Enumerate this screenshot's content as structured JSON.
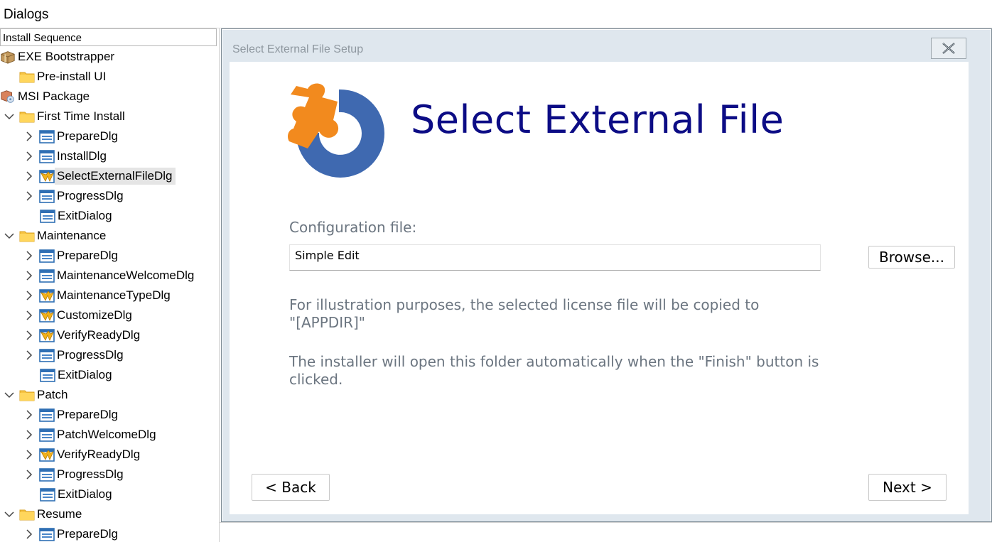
{
  "window": {
    "title": "Dialogs"
  },
  "sequence": {
    "selected": "Install Sequence"
  },
  "tree": [
    {
      "label": "EXE Bootstrapper",
      "icon": "package-icon",
      "arrow": false
    },
    {
      "label": "Pre-install UI",
      "icon": "folder-icon",
      "arrow": false
    },
    {
      "label": "MSI Package",
      "icon": "msi-package-icon",
      "arrow": false
    },
    {
      "label": "First Time Install",
      "icon": "folder-icon",
      "arrow": "down"
    },
    {
      "label": "PrepareDlg",
      "icon": "dialog-icon",
      "arrow": "right"
    },
    {
      "label": "InstallDlg",
      "icon": "dialog-icon",
      "arrow": "right"
    },
    {
      "label": "SelectExternalFileDlg",
      "icon": "custom-dialog-icon",
      "arrow": "right",
      "selected": true
    },
    {
      "label": "ProgressDlg",
      "icon": "dialog-icon",
      "arrow": "right"
    },
    {
      "label": "ExitDialog",
      "icon": "dialog-icon",
      "arrow": false
    },
    {
      "label": "Maintenance",
      "icon": "folder-icon",
      "arrow": "down"
    },
    {
      "label": "PrepareDlg",
      "icon": "dialog-icon",
      "arrow": "right"
    },
    {
      "label": "MaintenanceWelcomeDlg",
      "icon": "dialog-icon",
      "arrow": "right"
    },
    {
      "label": "MaintenanceTypeDlg",
      "icon": "custom-dialog-icon",
      "arrow": "right"
    },
    {
      "label": "CustomizeDlg",
      "icon": "custom-dialog-icon",
      "arrow": "right"
    },
    {
      "label": "VerifyReadyDlg",
      "icon": "custom-dialog-icon",
      "arrow": "right"
    },
    {
      "label": "ProgressDlg",
      "icon": "dialog-icon",
      "arrow": "right"
    },
    {
      "label": "ExitDialog",
      "icon": "dialog-icon",
      "arrow": false
    },
    {
      "label": "Patch",
      "icon": "folder-icon",
      "arrow": "down"
    },
    {
      "label": "PrepareDlg",
      "icon": "dialog-icon",
      "arrow": "right"
    },
    {
      "label": "PatchWelcomeDlg",
      "icon": "dialog-icon",
      "arrow": "right"
    },
    {
      "label": "VerifyReadyDlg",
      "icon": "custom-dialog-icon",
      "arrow": "right"
    },
    {
      "label": "ProgressDlg",
      "icon": "dialog-icon",
      "arrow": "right"
    },
    {
      "label": "ExitDialog",
      "icon": "dialog-icon",
      "arrow": false
    },
    {
      "label": "Resume",
      "icon": "folder-icon",
      "arrow": "down"
    },
    {
      "label": "PrepareDlg",
      "icon": "dialog-icon",
      "arrow": "right"
    }
  ],
  "dialog": {
    "caption": "Select External File Setup",
    "heading": "Select External File",
    "config_label": "Configuration file:",
    "config_value": "Simple Edit",
    "browse_label": "Browse...",
    "para1_line1": "For illustration purposes, the selected license file will be copied to",
    "para1_line2": "\"[APPDIR]\"",
    "para2_line1": "The installer will open this folder automatically when the \"Finish\" button is",
    "para2_line2": "clicked.",
    "back_label": "< Back",
    "next_label": "Next >",
    "colors": {
      "heading": "#0c0c85",
      "logo_orange": "#f28a1e",
      "logo_blue": "#3f69b0"
    }
  }
}
